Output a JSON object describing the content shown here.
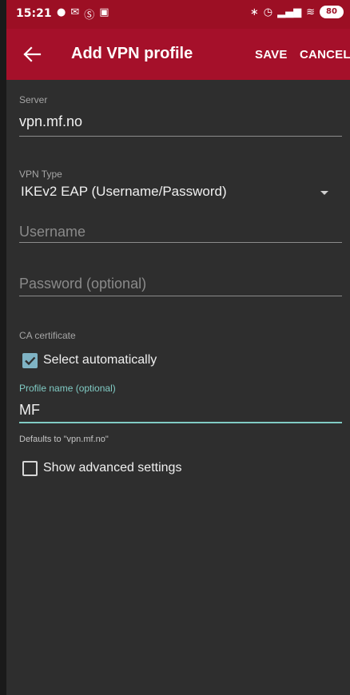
{
  "status_bar": {
    "time": "15:21",
    "left_icons": [
      "notification-dot-icon",
      "mail-icon",
      "skype-icon",
      "translate-icon"
    ],
    "right_icons": [
      "bluetooth-icon",
      "alarm-icon",
      "signal-icon",
      "wifi-icon"
    ],
    "battery": "80"
  },
  "toolbar": {
    "title": "Add VPN profile",
    "save_label": "SAVE",
    "cancel_label": "CANCEL"
  },
  "form": {
    "server": {
      "label": "Server",
      "value": "vpn.mf.no"
    },
    "vpn_type": {
      "label": "VPN Type",
      "value": "IKEv2 EAP (Username/Password)"
    },
    "username": {
      "placeholder": "Username"
    },
    "password": {
      "placeholder": "Password (optional)"
    },
    "ca_certificate": {
      "label": "CA certificate",
      "checkbox_label": "Select automatically",
      "checked": true
    },
    "profile_name": {
      "label": "Profile name (optional)",
      "value": "MF",
      "helper": "Defaults to \"vpn.mf.no\""
    },
    "advanced": {
      "checkbox_label": "Show advanced settings",
      "checked": false
    }
  },
  "colors": {
    "status_bar": "#9c0f24",
    "toolbar": "#a5102a",
    "background": "#2e2e2e",
    "accent": "#80cbc4"
  }
}
